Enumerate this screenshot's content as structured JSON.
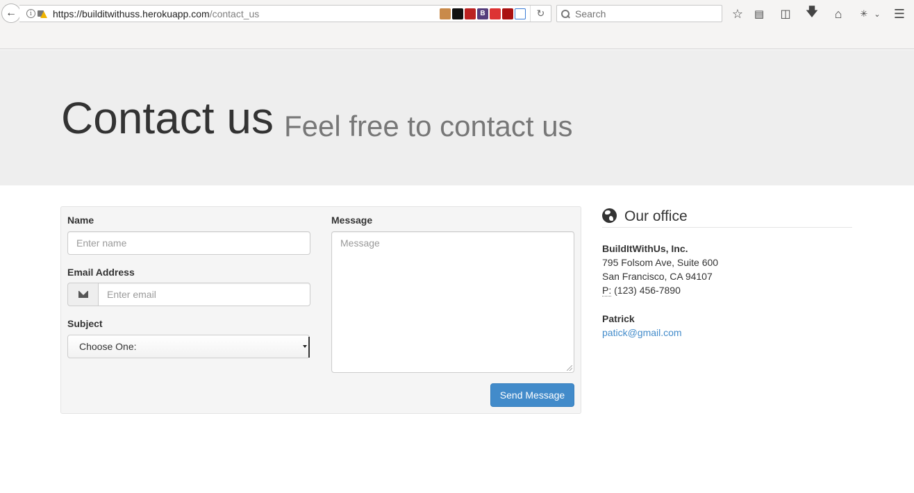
{
  "browser": {
    "url_host": "https://builditwithuss.herokuapp.com",
    "url_path": "/contact_us",
    "search_placeholder": "Search"
  },
  "header": {
    "title": "Contact us",
    "subtitle": "Feel free to contact us"
  },
  "form": {
    "name_label": "Name",
    "name_placeholder": "Enter name",
    "email_label": "Email Address",
    "email_placeholder": "Enter email",
    "subject_label": "Subject",
    "subject_selected": "Choose One:",
    "message_label": "Message",
    "message_placeholder": "Message",
    "send_label": "Send Message"
  },
  "office": {
    "title": "Our office",
    "company": "BuildItWithUs, Inc.",
    "street": "795 Folsom Ave, Suite 600",
    "city": "San Francisco, CA 94107",
    "phone_abbr": "P:",
    "phone": "(123) 456-7890",
    "contact_name": "Patrick",
    "contact_email": "patick@gmail.com"
  },
  "colors": {
    "primary": "#428bca",
    "jumbotron_bg": "#eeeeee",
    "well_bg": "#f5f5f5"
  }
}
